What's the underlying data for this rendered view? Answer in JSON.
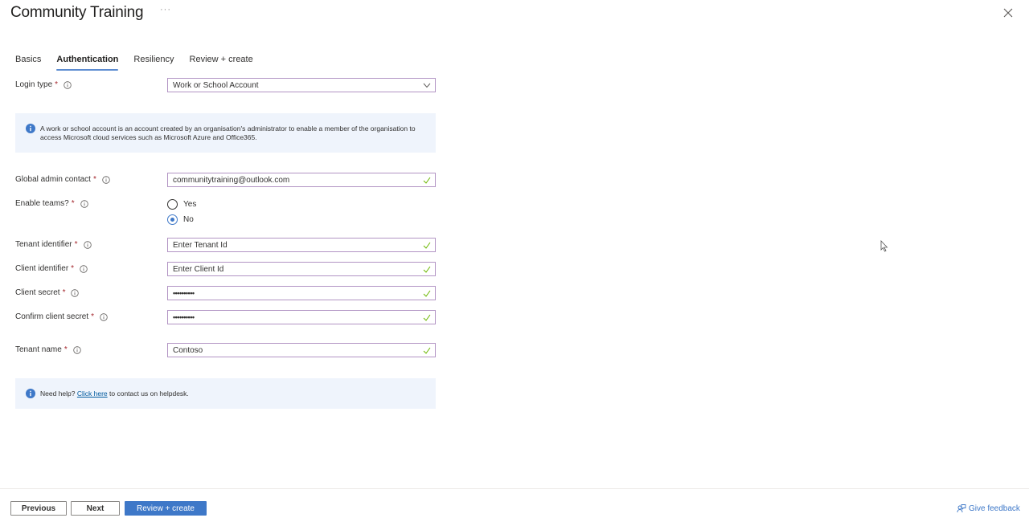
{
  "header": {
    "title": "Community Training",
    "more_label": "···",
    "close_icon": "close-icon"
  },
  "tabs": [
    {
      "label": "Basics",
      "active": false
    },
    {
      "label": "Authentication",
      "active": true
    },
    {
      "label": "Resiliency",
      "active": false
    },
    {
      "label": "Review + create",
      "active": false
    }
  ],
  "form": {
    "login_type": {
      "label": "Login type",
      "required": "*",
      "value": "Work or School Account"
    },
    "login_info": "A work or school account is an account created by an organisation's administrator to enable a member of the organisation to access Microsoft cloud services such as Microsoft Azure and Office365.",
    "global_admin": {
      "label": "Global admin contact",
      "required": "*",
      "value": "communitytraining@outlook.com"
    },
    "enable_teams": {
      "label": "Enable teams?",
      "required": "*",
      "options": [
        {
          "label": "Yes",
          "checked": false
        },
        {
          "label": "No",
          "checked": true
        }
      ]
    },
    "tenant_identifier": {
      "label": "Tenant identifier",
      "required": "*",
      "value": "Enter Tenant Id"
    },
    "client_identifier": {
      "label": "Client identifier",
      "required": "*",
      "value": "Enter Client Id"
    },
    "client_secret": {
      "label": "Client secret",
      "required": "*",
      "value": "••••••••••"
    },
    "confirm_client_secret": {
      "label": "Confirm client secret",
      "required": "*",
      "value": "••••••••••"
    },
    "tenant_name": {
      "label": "Tenant name",
      "required": "*",
      "value": "Contoso"
    },
    "help": {
      "prefix": "Need help?",
      "link": "Click here",
      "suffix": "to contact us on helpdesk."
    }
  },
  "footer": {
    "previous_label": "Previous",
    "next_label": "Next",
    "review_create_label": "Review + create",
    "feedback_label": "Give feedback"
  },
  "colors": {
    "accent": "#3e78c8",
    "valid_check": "#6bb700",
    "field_border": "#b294c4",
    "required": "#a4262c",
    "info_bg": "#eff4fc"
  }
}
